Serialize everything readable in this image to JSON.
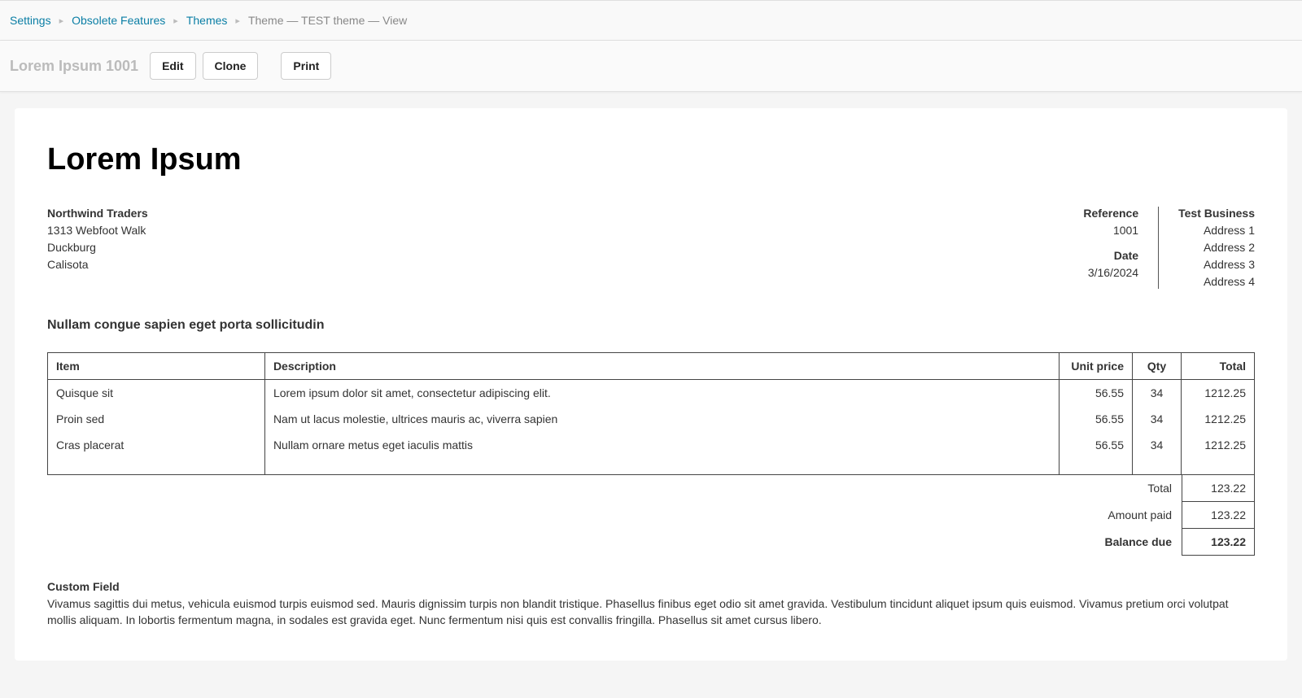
{
  "breadcrumb": {
    "items": [
      {
        "label": "Settings"
      },
      {
        "label": "Obsolete Features"
      },
      {
        "label": "Themes"
      }
    ],
    "current": "Theme — TEST theme — View"
  },
  "toolbar": {
    "title": "Lorem Ipsum 1001",
    "edit": "Edit",
    "clone": "Clone",
    "print": "Print"
  },
  "doc": {
    "title": "Lorem Ipsum",
    "from": {
      "name": "Northwind Traders",
      "line1": "1313 Webfoot Walk",
      "line2": "Duckburg",
      "line3": "Calisota"
    },
    "ref": {
      "reference_label": "Reference",
      "reference_value": "1001",
      "date_label": "Date",
      "date_value": "3/16/2024"
    },
    "business": {
      "name": "Test Business",
      "addr1": "Address 1",
      "addr2": "Address 2",
      "addr3": "Address 3",
      "addr4": "Address 4"
    },
    "section_title": "Nullam congue sapien eget porta sollicitudin",
    "columns": {
      "item": "Item",
      "description": "Description",
      "unit_price": "Unit price",
      "qty": "Qty",
      "total": "Total"
    },
    "rows": [
      {
        "item": "Quisque sit",
        "description": "Lorem ipsum dolor sit amet, consectetur adipiscing elit.",
        "unit_price": "56.55",
        "qty": "34",
        "total": "1212.25"
      },
      {
        "item": "Proin sed",
        "description": "Nam ut lacus molestie, ultrices mauris ac, viverra sapien",
        "unit_price": "56.55",
        "qty": "34",
        "total": "1212.25"
      },
      {
        "item": "Cras placerat",
        "description": "Nullam ornare metus eget iaculis mattis",
        "unit_price": "56.55",
        "qty": "34",
        "total": "1212.25"
      }
    ],
    "totals": [
      {
        "label": "Total",
        "value": "123.22",
        "bold": false
      },
      {
        "label": "Amount paid",
        "value": "123.22",
        "bold": false
      },
      {
        "label": "Balance due",
        "value": "123.22",
        "bold": true
      }
    ],
    "custom": {
      "title": "Custom Field",
      "body": "Vivamus sagittis dui metus, vehicula euismod turpis euismod sed. Mauris dignissim turpis non blandit tristique. Phasellus finibus eget odio sit amet gravida. Vestibulum tincidunt aliquet ipsum quis euismod. Vivamus pretium orci volutpat mollis aliquam. In lobortis fermentum magna, in sodales est gravida eget. Nunc fermentum nisi quis est convallis fringilla. Phasellus sit amet cursus libero."
    }
  }
}
